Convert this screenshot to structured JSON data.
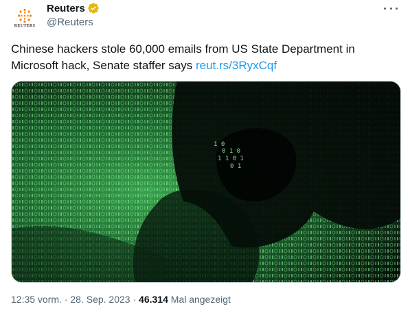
{
  "account": {
    "display_name": "Reuters",
    "handle": "@Reuters",
    "verified": true,
    "avatar_text": "REUTERS"
  },
  "tweet": {
    "text": "Chinese hackers stole 60,000 emails from US State Department in Microsoft hack, Senate staffer says ",
    "link": "reut.rs/3RyxCqf"
  },
  "meta": {
    "time": "12:35 vorm.",
    "separator": "·",
    "date": "28. Sep. 2023",
    "views_count": "46.314",
    "views_label": "Mal angezeigt"
  },
  "colors": {
    "accent": "#1d9bf0",
    "verified_badge": "#e2b719",
    "text_primary": "#0f1419",
    "text_secondary": "#536471",
    "reuters_orange": "#ff8000"
  },
  "icons": {
    "verified": "verified-badge-icon",
    "more": "more-options-icon",
    "logo": "reuters-logo-icon"
  }
}
